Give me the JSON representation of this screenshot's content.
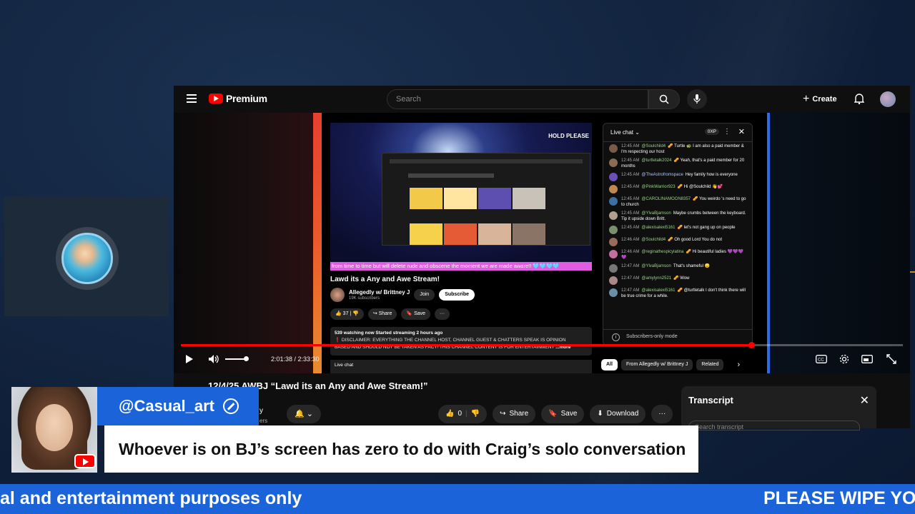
{
  "youtube": {
    "brand": "Premium",
    "search_placeholder": "Search",
    "create_label": "Create",
    "video_title": "12/4/25 AWBJ “Lawd its an Any and Awe Stream!”",
    "time_current": "2:01:38",
    "time_total": "2:33:30",
    "progress_fraction": 0.79,
    "actions": {
      "likes": "0",
      "share": "Share",
      "save": "Save",
      "download": "Download"
    },
    "transcript": {
      "title": "Transcript",
      "search_placeholder": "Search transcript"
    },
    "partial_channel": {
      "name_fragment": "y",
      "subs_fragment": "ers"
    }
  },
  "inner_stream": {
    "hold_text": "HOLD PLEASE",
    "banner": "from time to time but will delete rude and obscene the moment we are made aware!! 🩵🩵🩵🩵",
    "title": "Lawd its a Any and Awe Stream!",
    "channel": "Allegedly w/ Brittney J",
    "subs": "19K subscribers",
    "join": "Join",
    "subscribe": "Subscribe",
    "likes": "37",
    "share": "Share",
    "save": "Save",
    "desc_line1": "539 watching now  Started streaming 2 hours ago",
    "desc_line2": "❗ DISCLAIMER: EVERYTHING THE CHANNEL HOST, CHANNEL GUEST & CHATTERS SPEAK IS OPINION",
    "desc_line3": "BASED AND SHOULD NOT BE TAKEN AS FACT!  THIS CHANNEL CONTENT IS FOR ENTERTAINMENT",
    "more": "...more",
    "live_chat_label": "Live chat",
    "chat": {
      "header": "Live chat",
      "xp": "0XP",
      "footer": "Subscribers-only mode",
      "messages": [
        {
          "time": "12:45 AM",
          "user": "@Soulchild4",
          "text": "🥜 Turtle 🐢 I am also a paid member & I'm respecting our host"
        },
        {
          "time": "12:45 AM",
          "user": "@turtletalk2024",
          "text": "🥜 Yeah, that's a paid member for 20 months"
        },
        {
          "time": "12:45 AM",
          "user": "@TheAstrofromspace",
          "text": "Hey family how is everyone"
        },
        {
          "time": "12:45 AM",
          "user": "@PinkWarrior923",
          "text": "🥜 Hi @Soulchild 👋💕"
        },
        {
          "time": "12:45 AM",
          "user": "@CAROLINAMOON8357",
          "text": "🥜 You weirdo 's need to go to church"
        },
        {
          "time": "12:45 AM",
          "user": "@YlvaBjarnson",
          "text": "Maybe crumbs between the keyboard. Tip it upside down Britt."
        },
        {
          "time": "12:45 AM",
          "user": "@alexisalexi5161",
          "text": "🥜 let's not gang up on people"
        },
        {
          "time": "12:46 AM",
          "user": "@Soulchild4",
          "text": "🥜 Oh good Lord You do not"
        },
        {
          "time": "12:46 AM",
          "user": "@reginathespicylatina",
          "text": "🥜 Hi beautiful ladies 💜💜💜💜"
        },
        {
          "time": "12:47 AM",
          "user": "@YlvaBjarnson",
          "text": "That's shameful 😞"
        },
        {
          "time": "12:47 AM",
          "user": "@amylynn2521",
          "text": "🥜 Wow"
        },
        {
          "time": "12:47 AM",
          "user": "@alexisalexi5161",
          "text": "🥜 @turtletalk I don't think there will be true crime for a while."
        }
      ]
    },
    "chips": [
      "All",
      "From Allegedly w/ Brittney J",
      "Related"
    ]
  },
  "overlay": {
    "username": "@Casual_art",
    "comment": "Whoever is on BJ’s screen has zero to do with Craig’s solo conversation",
    "ticker_left": "al and entertainment purposes only",
    "ticker_right": "PLEASE WIPE YO"
  },
  "colors": {
    "yt_red": "#ff0000",
    "overlay_blue": "#1b63d8",
    "chat_user_green": "#9ad18b"
  }
}
